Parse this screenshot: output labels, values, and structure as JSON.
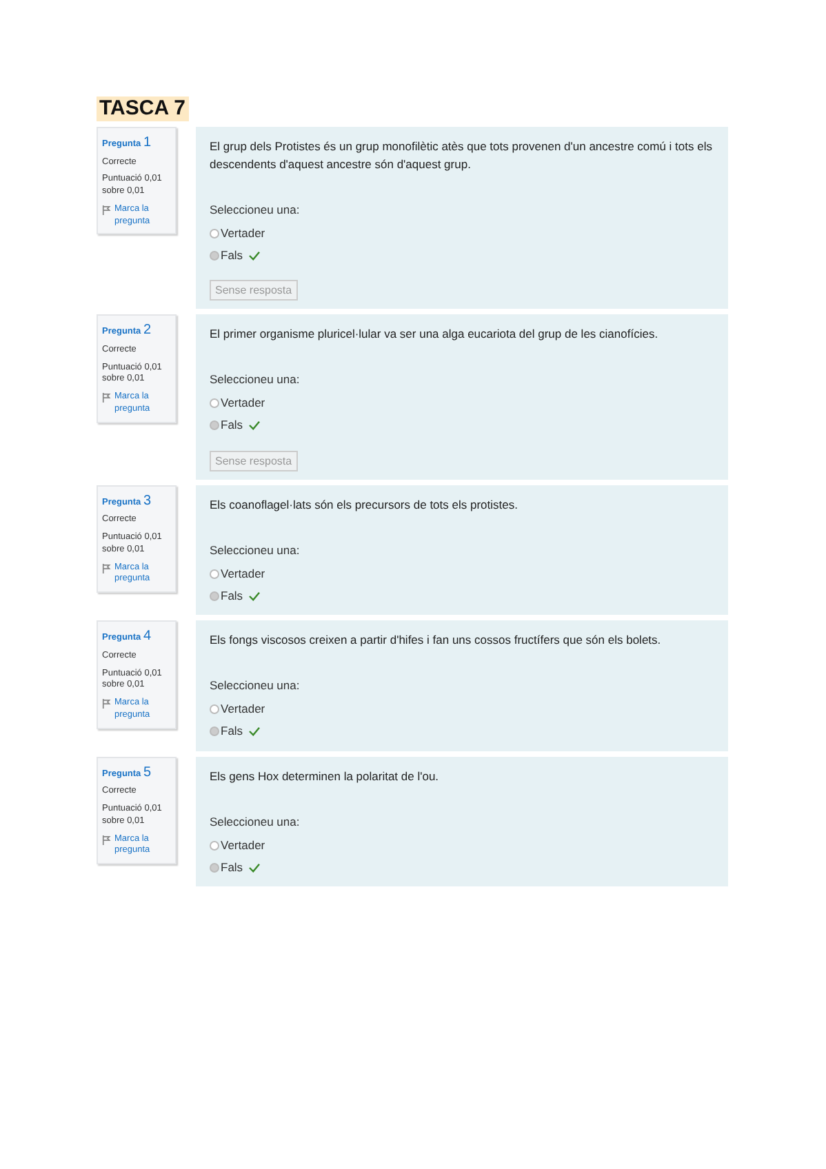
{
  "title": "TASCA 7",
  "questions": [
    {
      "label": "Pregunta",
      "number": "1",
      "status": "Correcte",
      "score": "Puntuació 0,01 sobre 0,01",
      "flag": "Marca la pregunta",
      "text": "El grup dels Protistes és un grup monofilètic atès que tots provenen d'un ancestre comú i tots els descendents d'aquest ancestre són d'aquest grup.",
      "prompt": "Seleccioneu una:",
      "options": [
        {
          "label": "Vertader",
          "selected": false,
          "correct": false
        },
        {
          "label": "Fals",
          "selected": true,
          "correct": true
        }
      ],
      "clear_button": "Sense resposta"
    },
    {
      "label": "Pregunta",
      "number": "2",
      "status": "Correcte",
      "score": "Puntuació 0,01 sobre 0,01",
      "flag": "Marca la pregunta",
      "text": "El primer organisme pluricel·lular va ser una alga eucariota del grup de les cianofícies.",
      "prompt": "Seleccioneu una:",
      "options": [
        {
          "label": "Vertader",
          "selected": false,
          "correct": false
        },
        {
          "label": "Fals",
          "selected": true,
          "correct": true
        }
      ],
      "clear_button": "Sense resposta"
    },
    {
      "label": "Pregunta",
      "number": "3",
      "status": "Correcte",
      "score": "Puntuació 0,01 sobre 0,01",
      "flag": "Marca la pregunta",
      "text": "Els coanoflagel·lats són els precursors de tots els protistes.",
      "prompt": "Seleccioneu una:",
      "options": [
        {
          "label": "Vertader",
          "selected": false,
          "correct": false
        },
        {
          "label": "Fals",
          "selected": true,
          "correct": true
        }
      ]
    },
    {
      "label": "Pregunta",
      "number": "4",
      "status": "Correcte",
      "score": "Puntuació 0,01 sobre 0,01",
      "flag": "Marca la pregunta",
      "text": "Els fongs viscosos creixen a partir d'hifes i fan uns cossos fructífers que són els bolets.",
      "prompt": "Seleccioneu una:",
      "options": [
        {
          "label": "Vertader",
          "selected": false,
          "correct": false
        },
        {
          "label": "Fals",
          "selected": true,
          "correct": true
        }
      ]
    },
    {
      "label": "Pregunta",
      "number": "5",
      "status": "Correcte",
      "score": "Puntuació 0,01 sobre 0,01",
      "flag": "Marca la pregunta",
      "text": "Els gens Hox determinen la polaritat de l'ou.",
      "prompt": "Seleccioneu una:",
      "options": [
        {
          "label": "Vertader",
          "selected": false,
          "correct": false
        },
        {
          "label": "Fals",
          "selected": true,
          "correct": true
        }
      ]
    }
  ]
}
